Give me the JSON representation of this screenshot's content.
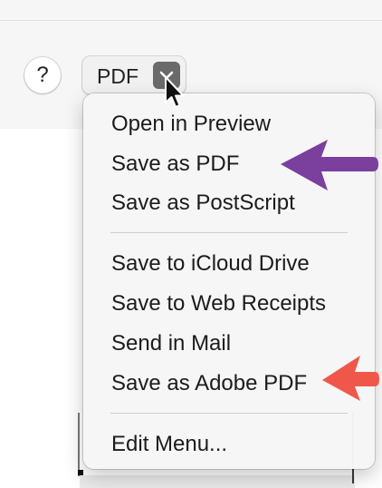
{
  "dialog": {
    "help_label": "?",
    "pdf_button_label": "PDF"
  },
  "menu": {
    "items": [
      {
        "label": "Open in Preview"
      },
      {
        "label": "Save as PDF"
      },
      {
        "label": "Save as PostScript"
      },
      {
        "label": "Save to iCloud Drive"
      },
      {
        "label": "Save to Web Receipts"
      },
      {
        "label": "Send in Mail"
      },
      {
        "label": "Save as Adobe PDF"
      },
      {
        "label": "Edit Menu..."
      }
    ]
  },
  "annotations": {
    "purple_arrow_color": "#7b3f9e",
    "red_arrow_color": "#f0574b"
  },
  "colors": {
    "dialog_bg": "#f6f6f6",
    "menu_bg": "#f6f6f6",
    "chevron_bg": "#6a6a6a"
  }
}
